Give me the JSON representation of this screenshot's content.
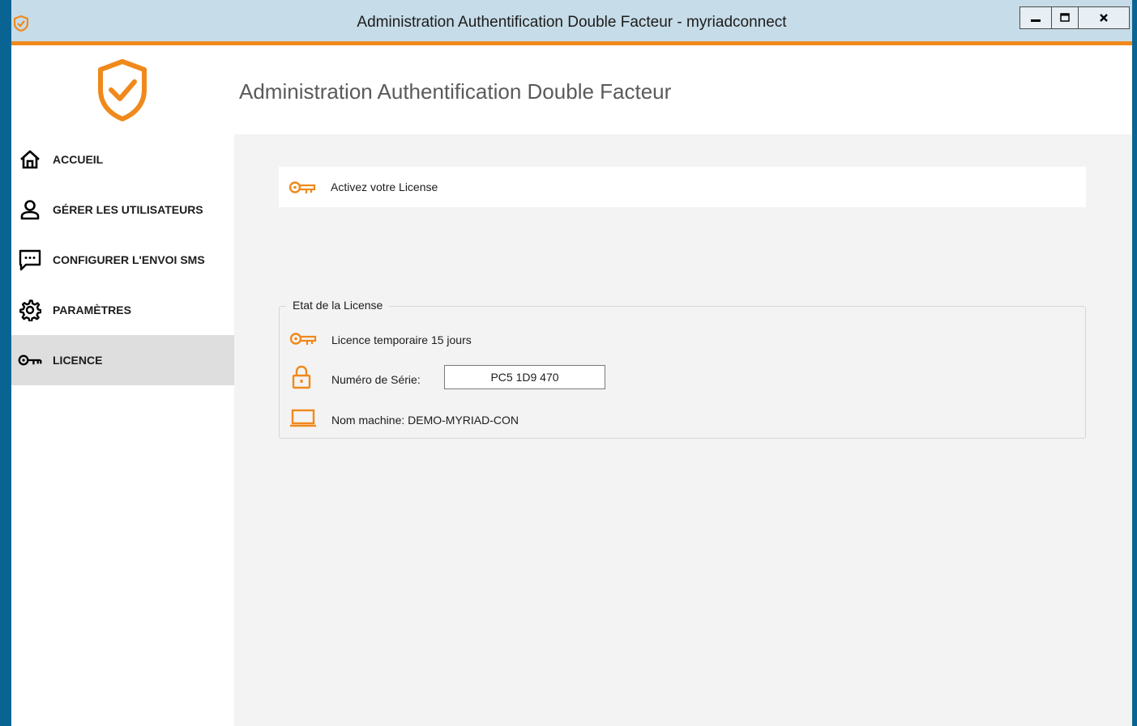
{
  "window": {
    "title": "Administration Authentification Double Facteur - myriadconnect",
    "controls": {
      "minimize_icon": "minimize-icon",
      "maximize_icon": "maximize-icon",
      "close_icon": "close-icon"
    }
  },
  "header": {
    "title": "Administration Authentification Double Facteur",
    "logo_icon": "shield-check-icon"
  },
  "sidebar": {
    "items": [
      {
        "label": "ACCUEIL",
        "icon": "home-icon",
        "active": false
      },
      {
        "label": "GÉRER LES UTILISATEURS",
        "icon": "user-icon",
        "active": false
      },
      {
        "label": "CONFIGURER L'ENVOI SMS",
        "icon": "message-icon",
        "active": false
      },
      {
        "label": "PARAMÈTRES",
        "icon": "gear-icon",
        "active": false
      },
      {
        "label": "LICENCE",
        "icon": "key-icon",
        "active": true
      }
    ]
  },
  "main": {
    "activate": {
      "label": "Activez votre License",
      "icon": "key-icon"
    },
    "license_state": {
      "legend": "Etat de la License",
      "temporary": "Licence temporaire 15 jours",
      "serial_label": "Numéro de Série:",
      "serial_value": "PC5 1D9 470",
      "machine_name": "Nom machine: DEMO-MYRIAD-CON"
    }
  },
  "colors": {
    "accent": "#f0891b",
    "titlebar": "#c6dce8",
    "desktop": "#0a6493",
    "content_bg": "#f3f3f3",
    "active_nav": "#dedede"
  }
}
